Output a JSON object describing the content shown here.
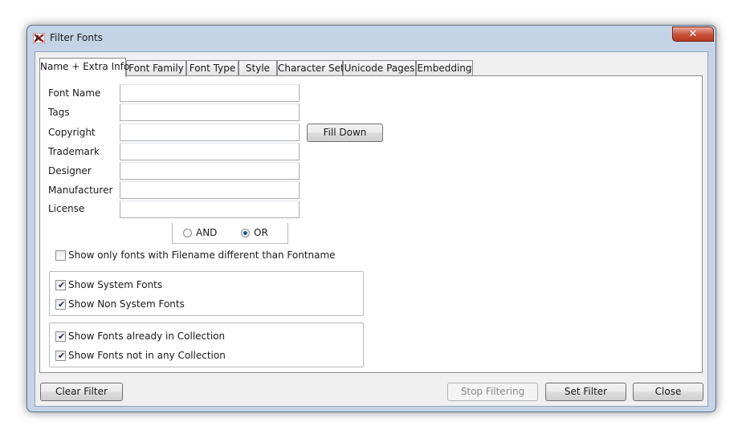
{
  "window": {
    "title": "Filter Fonts",
    "close_symbol": "✕",
    "app_icon": "font-filter-icon"
  },
  "tabs": [
    {
      "label": "Name + Extra Info",
      "active": true
    },
    {
      "label": "Font Family",
      "active": false
    },
    {
      "label": "Font Type",
      "active": false
    },
    {
      "label": "Style",
      "active": false
    },
    {
      "label": "Character Set",
      "active": false
    },
    {
      "label": "Unicode Pages",
      "active": false
    },
    {
      "label": "Embedding",
      "active": false
    }
  ],
  "fields": [
    {
      "label": "Font Name",
      "value": ""
    },
    {
      "label": "Tags",
      "value": ""
    },
    {
      "label": "Copyright",
      "value": ""
    },
    {
      "label": "Trademark",
      "value": ""
    },
    {
      "label": "Designer",
      "value": ""
    },
    {
      "label": "Manufacturer",
      "value": ""
    },
    {
      "label": "License",
      "value": ""
    }
  ],
  "fill_down_label": "Fill Down",
  "logic": {
    "and_label": "AND",
    "or_label": "OR",
    "selected": "OR"
  },
  "filename_check": {
    "label": "Show only fonts with Filename different than Fontname",
    "checked": false
  },
  "system_group": [
    {
      "label": "Show System Fonts",
      "checked": true
    },
    {
      "label": "Show Non System Fonts",
      "checked": true
    }
  ],
  "collection_group": [
    {
      "label": "Show Fonts already in Collection",
      "checked": true
    },
    {
      "label": "Show Fonts not in any Collection",
      "checked": true
    }
  ],
  "buttons": {
    "clear_filter": "Clear Filter",
    "stop_filtering": "Stop Filtering",
    "stop_filtering_enabled": false,
    "set_filter": "Set Filter",
    "close": "Close"
  },
  "check_glyph": "✔"
}
